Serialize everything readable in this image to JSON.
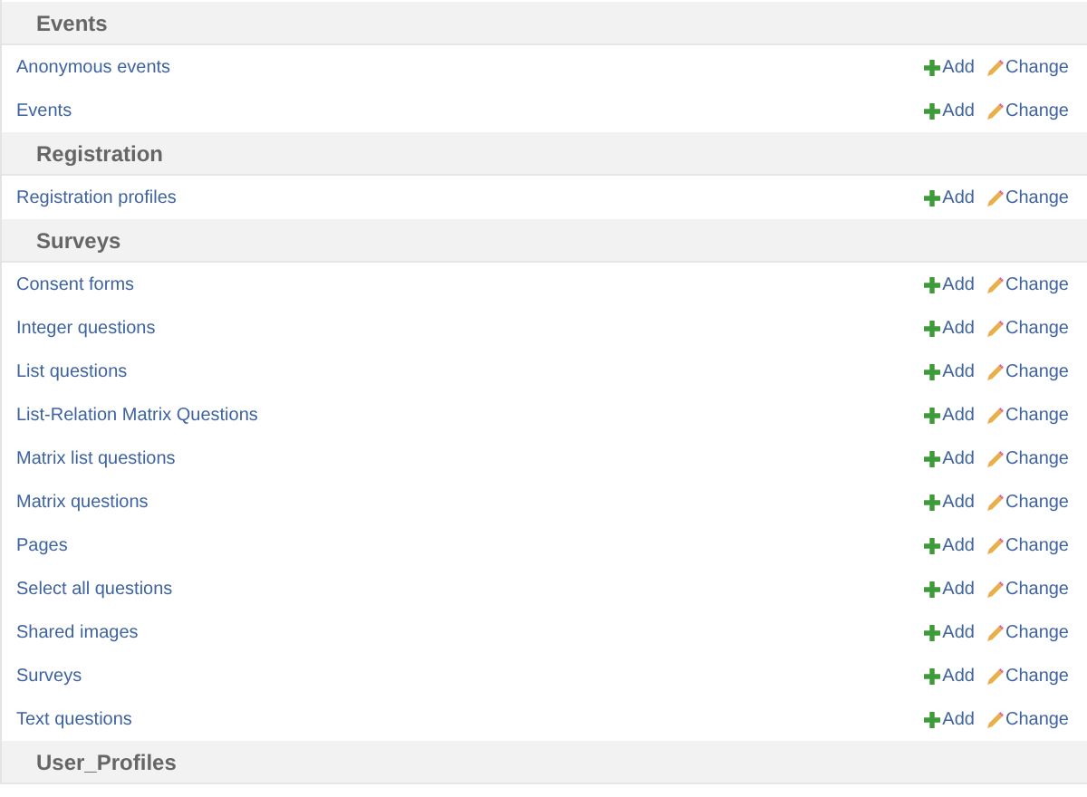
{
  "sections": [
    {
      "title": "Events",
      "models": [
        {
          "name": "Anonymous events",
          "add": "Add",
          "change": "Change"
        },
        {
          "name": "Events",
          "add": "Add",
          "change": "Change"
        }
      ]
    },
    {
      "title": "Registration",
      "models": [
        {
          "name": "Registration profiles",
          "add": "Add",
          "change": "Change"
        }
      ]
    },
    {
      "title": "Surveys",
      "models": [
        {
          "name": "Consent forms",
          "add": "Add",
          "change": "Change"
        },
        {
          "name": "Integer questions",
          "add": "Add",
          "change": "Change"
        },
        {
          "name": "List questions",
          "add": "Add",
          "change": "Change"
        },
        {
          "name": "List-Relation Matrix Questions",
          "add": "Add",
          "change": "Change"
        },
        {
          "name": "Matrix list questions",
          "add": "Add",
          "change": "Change"
        },
        {
          "name": "Matrix questions",
          "add": "Add",
          "change": "Change"
        },
        {
          "name": "Pages",
          "add": "Add",
          "change": "Change"
        },
        {
          "name": "Select all questions",
          "add": "Add",
          "change": "Change"
        },
        {
          "name": "Shared images",
          "add": "Add",
          "change": "Change"
        },
        {
          "name": "Surveys",
          "add": "Add",
          "change": "Change"
        },
        {
          "name": "Text questions",
          "add": "Add",
          "change": "Change"
        }
      ]
    },
    {
      "title": "User_Profiles"
    }
  ]
}
